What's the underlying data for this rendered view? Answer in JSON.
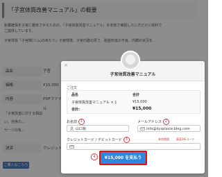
{
  "background": {
    "title": "「子宮体質改善マニュアル」の概要",
    "para1": "胎嚢確保を子宮に着床させるための、「子宮体質改善マニュアル」を本気で実践したい方だけに有料で",
    "para2": "ご提供しています。",
    "para3": "子宮体質「子宮隊(ジム)のあたり」子宮環境、子宮内膜の厚さ、胎盤形成の不良、内膜の状況を…",
    "rows": [
      {
        "label": "品名",
        "value": "子宮"
      },
      {
        "label": "価格",
        "value": "¥15,000"
      },
      {
        "label": "内容",
        "value": "PDFファイル"
      }
    ],
    "note1": "「子宮改善に対する相談",
    "note2": "い。自身の…",
    "note3": "サージの有…",
    "settlement_label": "決済",
    "settlement_value": "クレジットカード",
    "button_label": "ご購入はこちら"
  },
  "modal": {
    "close": "×",
    "title": "子宮体質改善マニュアル",
    "order_label": "ご注文",
    "table": {
      "col_item": "品名",
      "col_total": "合計",
      "item_name": "子宮体質改善マニュアル × 1",
      "item_total": "¥15,000",
      "total_label": "合計:",
      "total_value": "¥15,000"
    },
    "name_label": "お名前",
    "name_marker": "1",
    "name_value": "山口裕",
    "email_label": "メールアドレス",
    "email_marker": "2",
    "email_value": "info@dysplasia-blog.com",
    "card_label": "クレジットカード / デビットカード",
    "card_marker": "3",
    "card_note_expiry": "有効期限",
    "card_note_cvc": "裏面3桁コード",
    "card_placeholder": "",
    "pay_marker": "4",
    "pay_button": "¥15,000 を支払う"
  },
  "colors": {
    "pay_button": "#2e86e0",
    "highlight_border": "#e01212",
    "marker": "#dd3333"
  }
}
